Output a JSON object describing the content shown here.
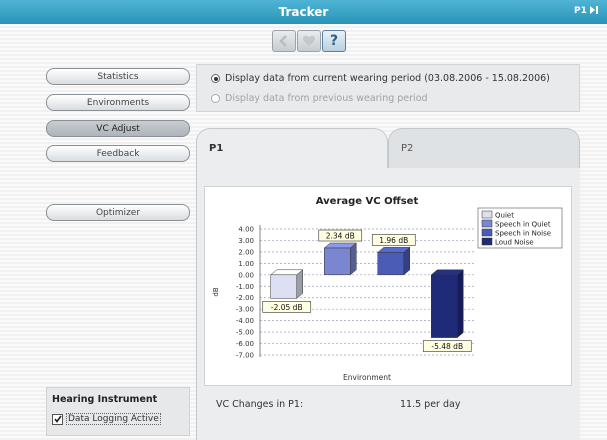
{
  "window": {
    "title": "Tracker",
    "program_badge": "P1"
  },
  "toolbar": {
    "back_icon": "chevron-left-icon",
    "home_icon": "heart-icon",
    "help_label": "?"
  },
  "nav": {
    "items": [
      {
        "label": "Statistics",
        "selected": false
      },
      {
        "label": "Environments",
        "selected": false
      },
      {
        "label": "VC Adjust",
        "selected": true
      },
      {
        "label": "Feedback",
        "selected": false
      }
    ],
    "optimizer_label": "Optimizer"
  },
  "period": {
    "current_label": "Display data from current wearing period (03.08.2006 - 15.08.2006)",
    "current_selected": true,
    "previous_label": "Display data from previous wearing period",
    "previous_enabled": false
  },
  "tabs": [
    {
      "label": "P1",
      "active": true
    },
    {
      "label": "P2",
      "active": false
    }
  ],
  "chart_data": {
    "type": "bar",
    "title": "Average VC Offset",
    "xlabel": "Environment",
    "ylabel": "dB",
    "ylim": [
      -7.0,
      4.0
    ],
    "yticks": [
      "4.00",
      "3.00",
      "2.00",
      "1.00",
      "0.00",
      "-1.00",
      "-2.00",
      "-3.00",
      "-4.00",
      "-5.00",
      "-6.00",
      "-7.00"
    ],
    "grid": true,
    "legend_position": "right",
    "series": [
      {
        "name": "Quiet",
        "value": -2.05,
        "label": "-2.05 dB",
        "color": "#dde0f2"
      },
      {
        "name": "Speech in Quiet",
        "value": 2.34,
        "label": "2.34 dB",
        "color": "#7a86cf"
      },
      {
        "name": "Speech in Noise",
        "value": 1.96,
        "label": "1.96 dB",
        "color": "#4a5cb6"
      },
      {
        "name": "Loud Noise",
        "value": -5.48,
        "label": "-5.48 dB",
        "color": "#1f2a78"
      }
    ]
  },
  "summary": {
    "label": "VC Changes in P1:",
    "value": "11.5 per day"
  },
  "hearing_instrument": {
    "title": "Hearing Instrument",
    "checkbox_label": "Data Logging Active",
    "checked": true
  }
}
